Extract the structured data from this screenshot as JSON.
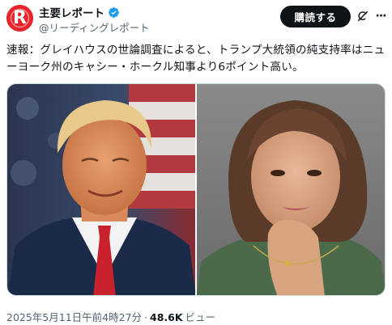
{
  "header": {
    "display_name": "主要レポート",
    "handle": "@リーディングレポート",
    "avatar_letter": "R",
    "subscribe_label": "購読する",
    "more_label": "···"
  },
  "post": {
    "text": "速報：グレイハウスの世論調査によると、トランプ大統領の純支持率はニューヨーク州のキャシー・ホークル知事より6ポイント高い。"
  },
  "footer": {
    "timestamp": "2025年5月11日午前4時27分",
    "separator": "·",
    "views_count": "48.6K",
    "views_label": "ビュー"
  },
  "colors": {
    "brand": "#e5242b",
    "verified": "#1d9bf0",
    "button_bg": "#0f1419",
    "muted_text": "#536471"
  },
  "icons": {
    "verified": "verified-badge-icon",
    "grok": "grok-icon",
    "more": "more-icon"
  }
}
